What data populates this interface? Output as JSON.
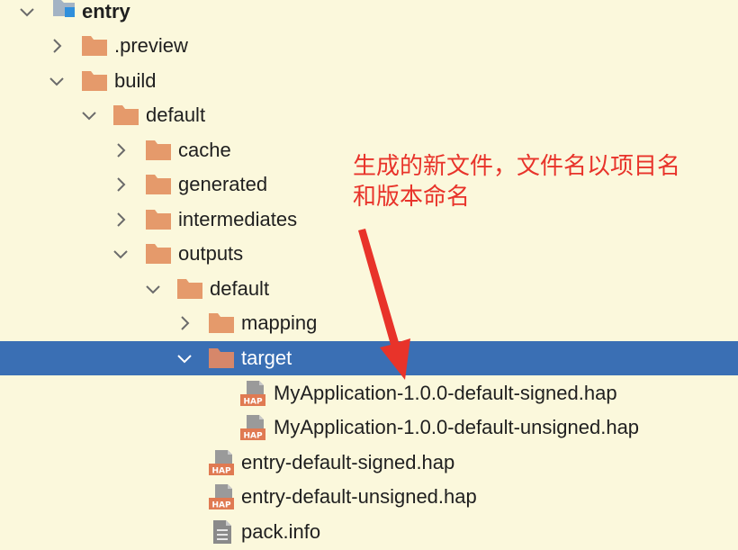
{
  "tree": {
    "root": {
      "label": "entry"
    },
    "items": [
      {
        "label": ".preview"
      },
      {
        "label": "build"
      },
      {
        "label": "default"
      },
      {
        "label": "cache"
      },
      {
        "label": "generated"
      },
      {
        "label": "intermediates"
      },
      {
        "label": "outputs"
      },
      {
        "label": "default"
      },
      {
        "label": "mapping"
      },
      {
        "label": "target"
      },
      {
        "label": "MyApplication-1.0.0-default-signed.hap"
      },
      {
        "label": "MyApplication-1.0.0-default-unsigned.hap"
      },
      {
        "label": "entry-default-signed.hap"
      },
      {
        "label": "entry-default-unsigned.hap"
      },
      {
        "label": "pack.info"
      }
    ],
    "hap_badge": "HAP",
    "selected_item": "target"
  },
  "annotation": {
    "line1": "生成的新文件，文件名以项目名",
    "line2": "和版本命名"
  },
  "colors": {
    "background": "#fbf8dc",
    "selection": "#3a6fb4",
    "folder": "#e59a6b",
    "annotation": "#e8332a"
  },
  "icons": {
    "chevron_expanded": "chevron-down-icon",
    "chevron_collapsed": "chevron-right-icon",
    "folder": "folder-icon",
    "hap": "hap-file-icon",
    "info_file": "text-file-icon",
    "module": "module-icon"
  }
}
